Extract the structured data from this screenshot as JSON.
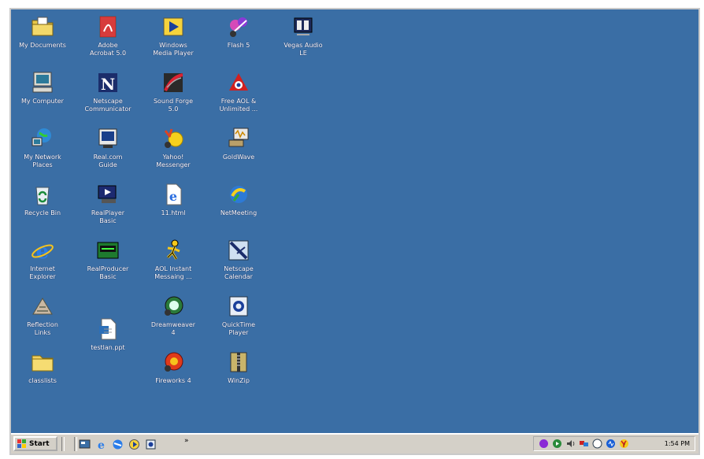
{
  "desktop": {
    "background_color": "#3a6ea5",
    "icons": [
      {
        "label": "My Documents",
        "icon": "folder-documents-icon"
      },
      {
        "label": "My Computer",
        "icon": "computer-icon"
      },
      {
        "label": "My Network\nPlaces",
        "icon": "network-places-icon"
      },
      {
        "label": "Recycle Bin",
        "icon": "recycle-bin-icon"
      },
      {
        "label": "Internet\nExplorer",
        "icon": "internet-explorer-icon"
      },
      {
        "label": "Reflection\nLinks",
        "icon": "reflection-links-icon"
      },
      {
        "label": "classlists",
        "icon": "folder-icon"
      },
      {
        "label": "Adobe\nAcrobat 5.0",
        "icon": "acrobat-icon"
      },
      {
        "label": "Netscape\nCommunicator",
        "icon": "netscape-icon"
      },
      {
        "label": "Real.com\nGuide",
        "icon": "real-guide-icon"
      },
      {
        "label": "RealPlayer\nBasic",
        "icon": "realplayer-icon"
      },
      {
        "label": "RealProducer\nBasic",
        "icon": "realproducer-icon"
      },
      {
        "label": "testlan.ppt",
        "icon": "document-icon"
      },
      {
        "label": "Windows\nMedia Player",
        "icon": "media-player-icon"
      },
      {
        "label": "Sound Forge\n5.0",
        "icon": "sound-forge-icon"
      },
      {
        "label": "Yahoo!\nMessenger",
        "icon": "yahoo-messenger-icon"
      },
      {
        "label": "11.html",
        "icon": "html-file-icon"
      },
      {
        "label": "AOL Instant\nMessaing ...",
        "icon": "aim-icon"
      },
      {
        "label": "Dreamweaver\n4",
        "icon": "dreamweaver-icon"
      },
      {
        "label": "Fireworks 4",
        "icon": "fireworks-icon"
      },
      {
        "label": "Flash 5",
        "icon": "flash-icon"
      },
      {
        "label": "Free AOL &\nUnlimited ...",
        "icon": "aol-icon"
      },
      {
        "label": "GoldWave",
        "icon": "goldwave-icon"
      },
      {
        "label": "NetMeeting",
        "icon": "netmeeting-icon"
      },
      {
        "label": "Netscape\nCalendar",
        "icon": "netscape-calendar-icon"
      },
      {
        "label": "QuickTime\nPlayer",
        "icon": "quicktime-icon"
      },
      {
        "label": "WinZip",
        "icon": "winzip-icon"
      },
      {
        "label": "Vegas Audio\nLE",
        "icon": "vegas-audio-icon"
      }
    ]
  },
  "taskbar": {
    "start_label": "Start",
    "quick_launch": [
      "show-desktop-icon",
      "internet-explorer-icon",
      "outlook-express-icon",
      "media-player-icon",
      "calendar-icon"
    ],
    "chevron": "»",
    "tray_icons": [
      "antivirus-icon",
      "realplayer-tray-icon",
      "volume-icon",
      "network-tray-icon",
      "aol-tray-icon",
      "messenger-tray-icon",
      "yahoo-tray-icon"
    ],
    "clock": "1:54 PM"
  }
}
